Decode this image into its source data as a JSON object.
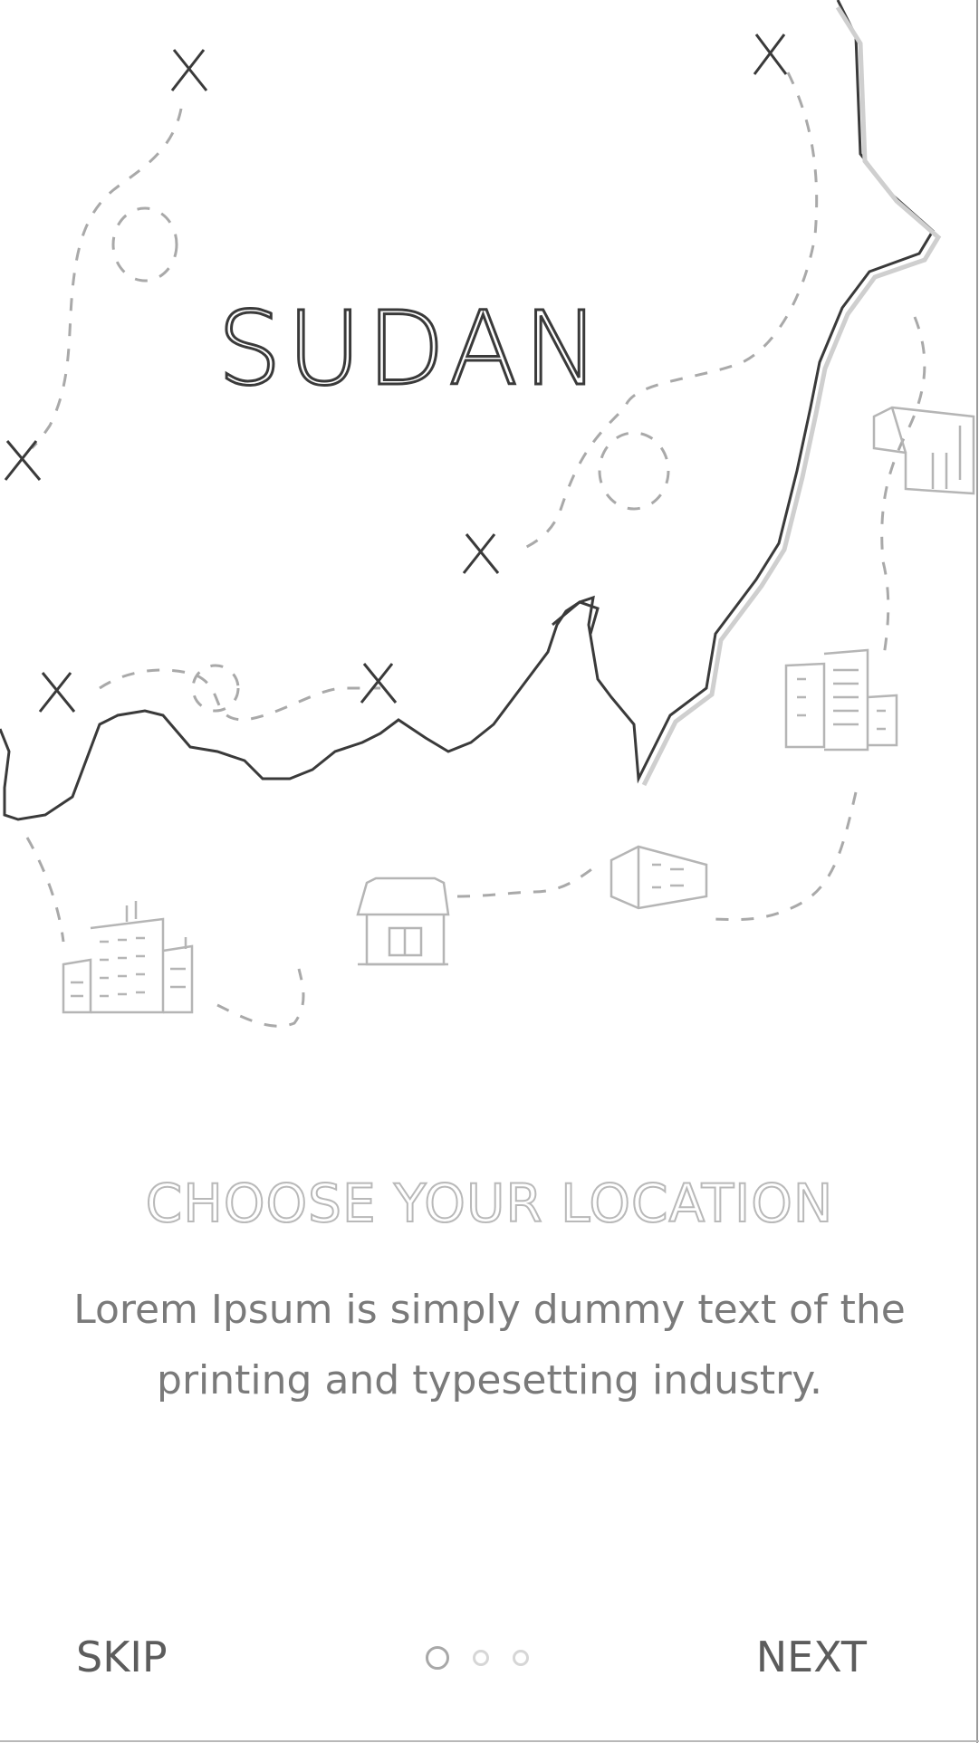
{
  "map": {
    "label": "SUDAN"
  },
  "onboarding": {
    "title": "CHOOSE YOUR LOCATION",
    "description": "Lorem Ipsum is simply dummy text of the printing and typesetting industry."
  },
  "footer": {
    "skip_label": "SKIP",
    "next_label": "NEXT",
    "page_indicator": {
      "total": 3,
      "active_index": 0
    }
  },
  "colors": {
    "background": "#ffffff",
    "map_outline": "#3a3a3a",
    "dashed_route": "#a9a9a9",
    "title_outline": "#b9b9b9",
    "body_text": "#7a7a7a",
    "button_text": "#5c5c5c"
  }
}
